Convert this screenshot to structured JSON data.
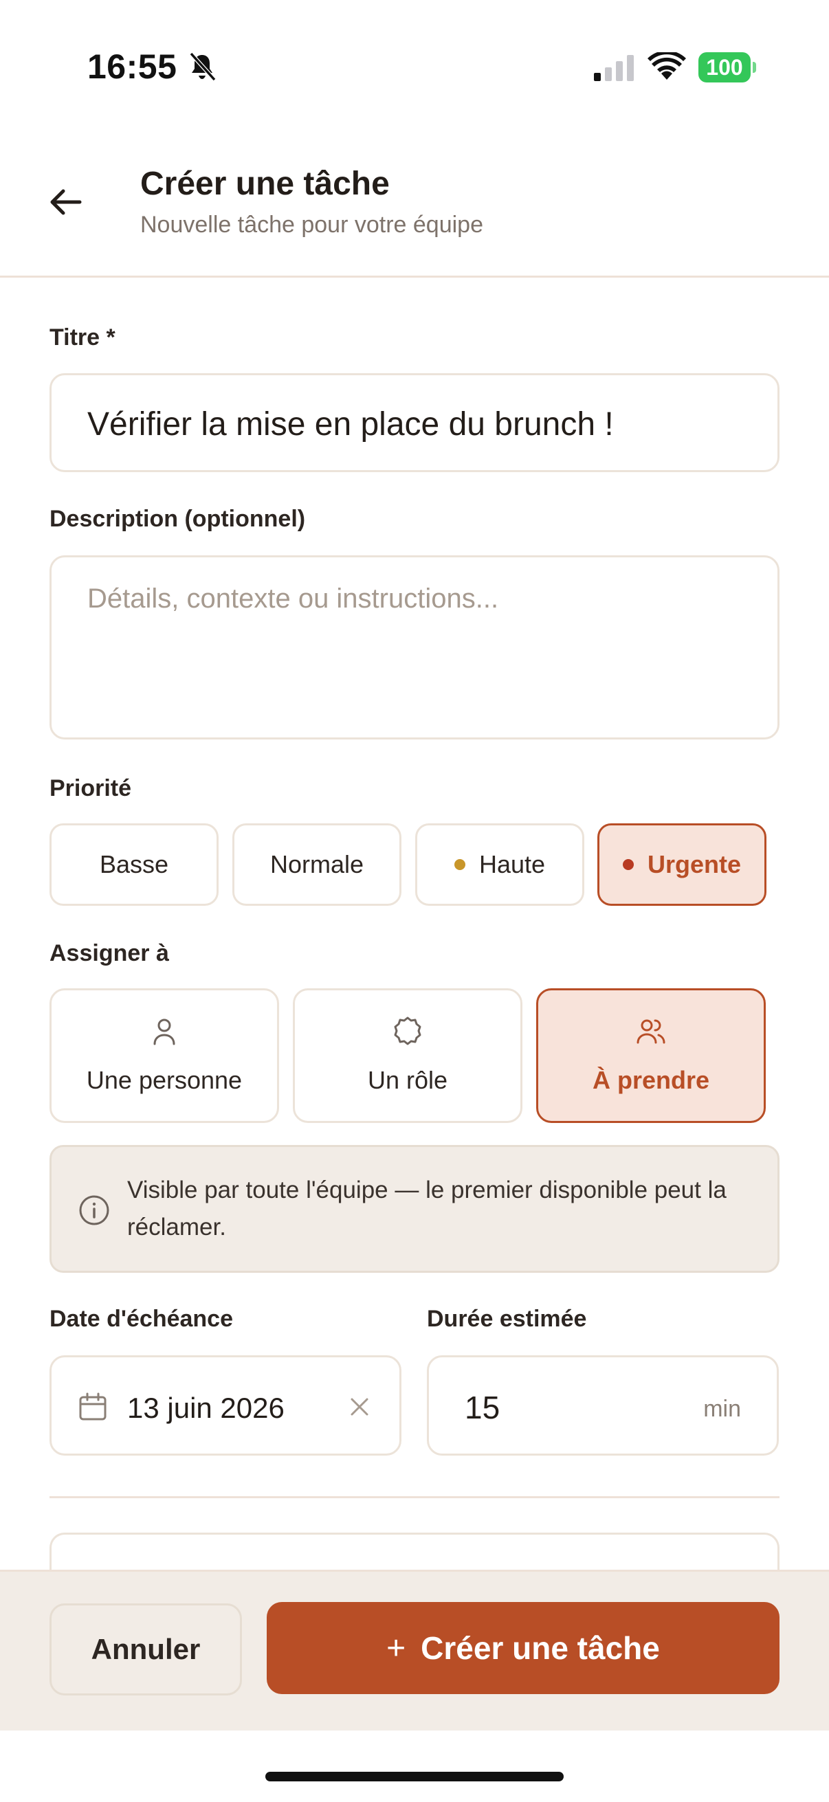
{
  "status_bar": {
    "time": "16:55",
    "battery": "100"
  },
  "header": {
    "title": "Créer une tâche",
    "subtitle": "Nouvelle tâche pour votre équipe"
  },
  "form": {
    "title_label": "Titre *",
    "title_value": "Vérifier la mise en place du brunch !",
    "description_label": "Description (optionnel)",
    "description_placeholder": "Détails, contexte ou instructions...",
    "priority_label": "Priorité",
    "priorities": [
      {
        "label": "Basse",
        "active": false
      },
      {
        "label": "Normale",
        "active": false
      },
      {
        "label": "Haute",
        "active": false,
        "dot_color": "#c8962a"
      },
      {
        "label": "Urgente",
        "active": true,
        "dot_color": "#b83a22"
      }
    ],
    "assign_label": "Assigner à",
    "assign_options": [
      {
        "label": "Une personne",
        "icon": "user-icon",
        "active": false
      },
      {
        "label": "Un rôle",
        "icon": "role-badge-icon",
        "active": false
      },
      {
        "label": "À prendre",
        "icon": "users-icon",
        "active": true
      }
    ],
    "info_text": "Visible par toute l'équipe — le premier disponible peut la réclamer.",
    "due_date_label": "Date d'échéance",
    "due_date_value": "13 juin 2026",
    "duration_label": "Durée estimée",
    "duration_value": "15",
    "duration_unit": "min"
  },
  "footer": {
    "cancel_label": "Annuler",
    "create_label": "Créer une tâche"
  },
  "colors": {
    "accent": "#b84e26",
    "accent_bg": "#f8e3da",
    "border": "#ece3d9",
    "footer_bg": "#f2ece6"
  }
}
